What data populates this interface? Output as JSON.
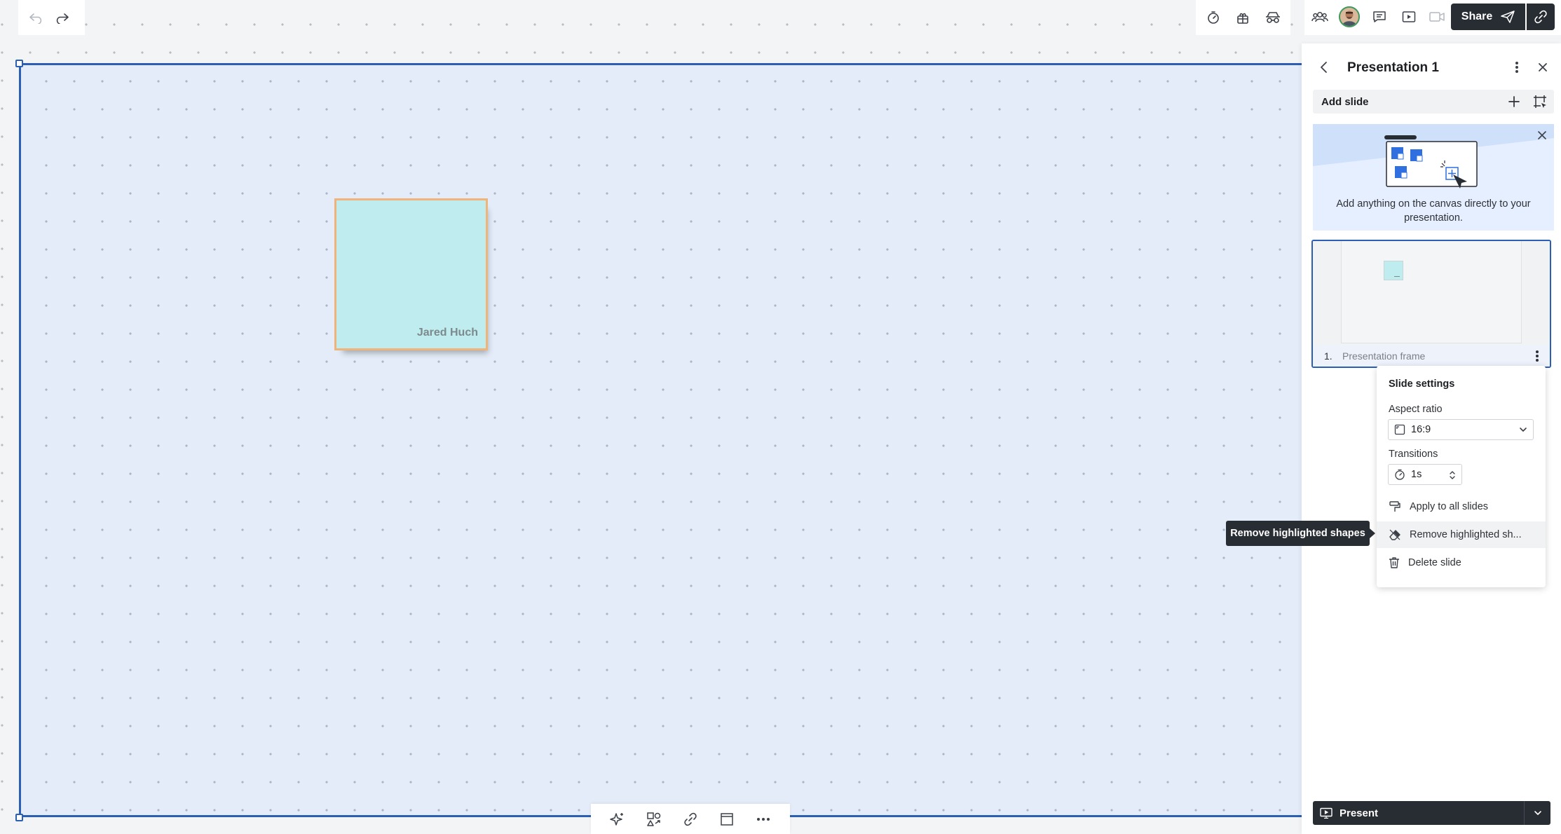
{
  "topbar": {
    "undo_icon": "undo-icon",
    "redo_icon": "redo-icon",
    "right_tools": [
      "timer-icon",
      "gift-icon",
      "private-mode-icon"
    ],
    "collab_tools": [
      "collaborators-icon",
      "comment-icon",
      "present-icon",
      "video-icon"
    ],
    "share_label": "Share"
  },
  "canvas": {
    "frame_color": "#2b5fb3",
    "sticky": {
      "author": "Jared Huch",
      "fill": "#bfecef",
      "border": "#f0b47a"
    }
  },
  "bottom_toolbar": [
    "ai-sparkle-icon",
    "shapes-icon",
    "link-icon",
    "frame-icon",
    "more-icon"
  ],
  "panel": {
    "title": "Presentation 1",
    "add_slide_label": "Add slide",
    "promo_text": "Add anything on the canvas directly to your presentation.",
    "slides": [
      {
        "number": "1.",
        "name": "Presentation frame"
      }
    ],
    "present_label": "Present"
  },
  "slide_settings": {
    "title": "Slide settings",
    "aspect_ratio_label": "Aspect ratio",
    "aspect_ratio_value": "16:9",
    "transitions_label": "Transitions",
    "transitions_value": "1s",
    "items": {
      "apply_all": "Apply to all slides",
      "remove_highlighted": "Remove highlighted sh...",
      "delete": "Delete slide"
    }
  },
  "tooltip": {
    "text": "Remove highlighted shapes"
  }
}
